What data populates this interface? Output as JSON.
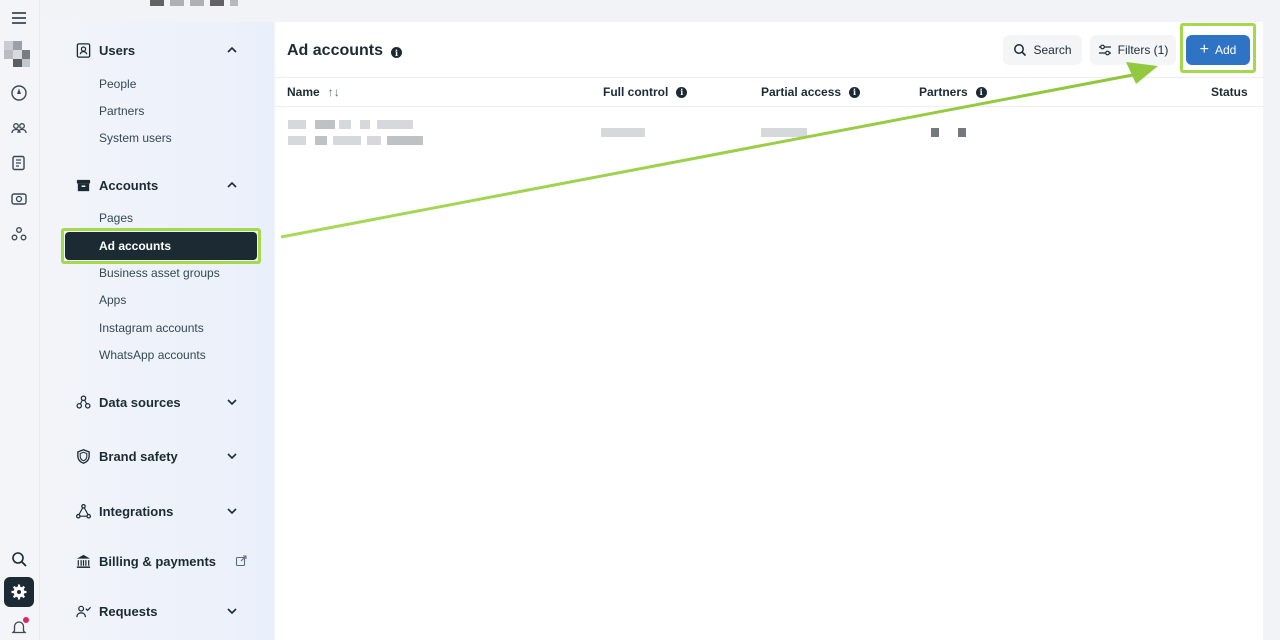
{
  "rail": {
    "menu_icon": "menu-icon",
    "icons": [
      "compass-icon",
      "people-icon",
      "pages-icon",
      "catalog-icon",
      "network-icon"
    ],
    "bottom_icons": [
      "search-icon",
      "gear-icon",
      "bell-icon"
    ]
  },
  "nav": {
    "groups": [
      {
        "label": "Users",
        "icon": "users-icon",
        "expanded": true,
        "items": [
          "People",
          "Partners",
          "System users"
        ]
      },
      {
        "label": "Accounts",
        "icon": "accounts-icon",
        "expanded": true,
        "items": [
          "Pages",
          "Ad accounts",
          "Business asset groups",
          "Apps",
          "Instagram accounts",
          "WhatsApp accounts"
        ],
        "active_item": "Ad accounts"
      },
      {
        "label": "Data sources",
        "icon": "data-sources-icon",
        "expanded": false
      },
      {
        "label": "Brand safety",
        "icon": "shield-icon",
        "expanded": false
      },
      {
        "label": "Integrations",
        "icon": "integrations-icon",
        "expanded": false
      },
      {
        "label": "Billing & payments",
        "icon": "bank-icon",
        "external": true
      },
      {
        "label": "Requests",
        "icon": "requests-icon",
        "expanded": false
      }
    ]
  },
  "main": {
    "title": "Ad accounts",
    "buttons": {
      "search": "Search",
      "filters": "Filters (1)",
      "add": "Add"
    },
    "columns": [
      "Name",
      "Full control",
      "Partial access",
      "Partners",
      "Status"
    ]
  },
  "colors": {
    "accent": "#2f73c5",
    "dark": "#1c2b33",
    "highlight": "#a5d84a"
  }
}
